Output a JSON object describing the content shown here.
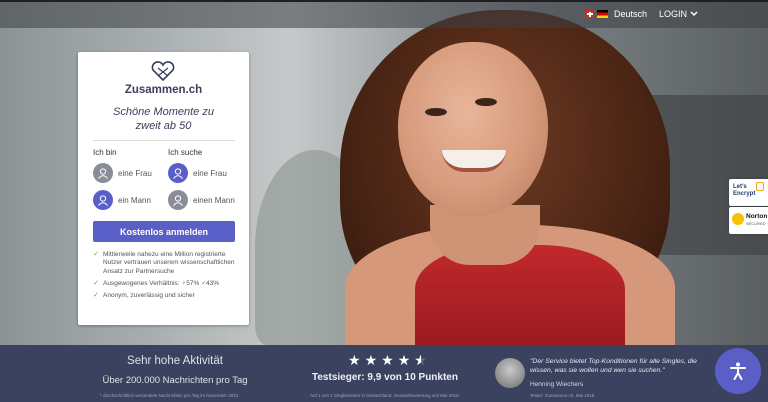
{
  "topbar": {
    "language_label": "Deutsch",
    "login_label": "LOGIN"
  },
  "card": {
    "brand": "Zusammen.ch",
    "tagline_line1": "Schöne Momente zu",
    "tagline_line2": "zweit ab 50",
    "i_am_label": "Ich bin",
    "seeking_label": "Ich suche",
    "i_am_options": [
      "eine Frau",
      "ein Mann"
    ],
    "seeking_options": [
      "eine Frau",
      "einen Mann"
    ],
    "cta_label": "Kostenlos anmelden",
    "bullets": [
      "Mittlerweile nahezu eine Million registrierte Nutzer vertrauen unserem wissenschaftlichen Ansatz zur Partnersuche",
      "Ausgewogenes Verhältnis: ♀57% ♂43%",
      "Anonym, zuverlässig und sicher"
    ]
  },
  "badges": {
    "encrypt_line1": "Let's",
    "encrypt_line2": "Encrypt",
    "norton_line1": "Norton",
    "norton_line2": "SECURED"
  },
  "footer": {
    "activity_title": "Sehr hohe Aktivität",
    "activity_sub": "Über 200.000 Nachrichten pro Tag",
    "activity_fine": "* durchschnittlich versendete Nachrichten pro Tag im November 2024",
    "rating_stars": 4.5,
    "rating_label": "Testsieger: 9,9 von 10 Punkten",
    "rating_fine": "Auf 1 von 1 Singlebörsen in Deutschland, Gesamtbewertung seit Mai 2019",
    "quote": "\"Der Service bietet Top-Konditionen für alle Singles, die wissen, was sie wollen und wen sie suchen.\"",
    "tester_name": "Henning Wiechers",
    "tester_fine": "Tester: Zusammen.ch, Mai 2019"
  },
  "colors": {
    "accent": "#5a5fc7",
    "footer_bg": "#3b4260",
    "check_green": "#3fa877"
  }
}
